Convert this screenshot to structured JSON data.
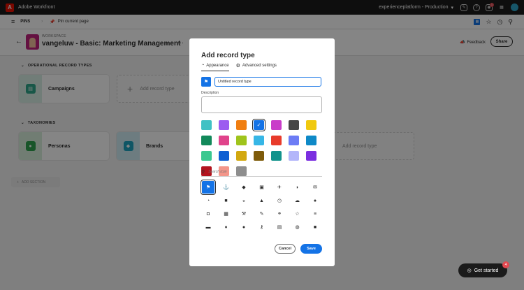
{
  "topbar": {
    "app_name": "Adobe Workfront",
    "org": "experienceplatform - Production",
    "notification_count": "1"
  },
  "pinsbar": {
    "pins_label": "PINS",
    "pin_current": "Pin current page"
  },
  "header": {
    "workspace_label": "WORKSPACE",
    "workspace_title": "vangeluw - Basic: Marketing Management",
    "feedback": "Feedback",
    "share": "Share"
  },
  "sections": {
    "operational": {
      "title": "OPERATIONAL RECORD TYPES",
      "cards": [
        {
          "name": "Campaigns",
          "color": "#2ea88a"
        }
      ],
      "add_label": "Add record type"
    },
    "taxonomies": {
      "title": "TAXONOMIES",
      "cards": [
        {
          "name": "Personas",
          "color": "#2ea44f"
        },
        {
          "name": "Brands",
          "color": "#1ea6c1"
        }
      ],
      "add_label": "Add record type"
    },
    "add_section": "ADD SECTION"
  },
  "modal": {
    "title": "Add record type",
    "tabs": [
      {
        "label": "Appearance",
        "icon": "brush-icon",
        "active": true
      },
      {
        "label": "Advanced settings",
        "icon": "gear-icon",
        "active": false
      }
    ],
    "name_value": "Untitled record type",
    "description_label": "Description",
    "description_value": "",
    "colors": [
      "#40c1c4",
      "#9c5cf0",
      "#f07e11",
      "#1473e6",
      "#c93dc9",
      "#464646",
      "#f0c90f",
      "#12895a",
      "#e0438b",
      "#9fc41c",
      "#36b6e6",
      "#e83b2b",
      "#6c7cf5",
      "#0e89c7",
      "#3bc890",
      "#0f5fd2",
      "#d2a80f",
      "#7e5b0a",
      "#12938c",
      "#b3b6fa",
      "#7b2fe0",
      "#b3141e",
      "#f3968a",
      "#8e8e8e"
    ],
    "selected_color_index": 3,
    "search_placeholder": "Search icon",
    "icons": [
      {
        "name": "flag-icon",
        "glyph": "⚑"
      },
      {
        "name": "anchor-icon",
        "glyph": "⚓"
      },
      {
        "name": "tag-icon",
        "glyph": "◆"
      },
      {
        "name": "image-icon",
        "glyph": "▣"
      },
      {
        "name": "airplane-icon",
        "glyph": "✈"
      },
      {
        "name": "shield-icon",
        "glyph": "◗"
      },
      {
        "name": "email-icon",
        "glyph": "✉"
      },
      {
        "name": "brush-icon",
        "glyph": "◔"
      },
      {
        "name": "box-icon",
        "glyph": "■"
      },
      {
        "name": "car-icon",
        "glyph": "◒"
      },
      {
        "name": "alert-icon",
        "glyph": "▲"
      },
      {
        "name": "clock-icon",
        "glyph": "◷"
      },
      {
        "name": "cloud-icon",
        "glyph": "☁"
      },
      {
        "name": "bell-icon",
        "glyph": "♠"
      },
      {
        "name": "money-icon",
        "glyph": "◘"
      },
      {
        "name": "calculator-icon",
        "glyph": "▦"
      },
      {
        "name": "hammer-icon",
        "glyph": "⚒"
      },
      {
        "name": "pencil-icon",
        "glyph": "✎"
      },
      {
        "name": "link-icon",
        "glyph": "⚭"
      },
      {
        "name": "star-icon",
        "glyph": "☆"
      },
      {
        "name": "database-icon",
        "glyph": "≡"
      },
      {
        "name": "briefcase-icon",
        "glyph": "▬"
      },
      {
        "name": "location-icon",
        "glyph": "♦"
      },
      {
        "name": "target-icon",
        "glyph": "●"
      },
      {
        "name": "key-icon",
        "glyph": "⚷"
      },
      {
        "name": "calendar-icon",
        "glyph": "▤"
      },
      {
        "name": "globe-icon",
        "glyph": "◍"
      },
      {
        "name": "video-icon",
        "glyph": "■"
      }
    ],
    "selected_icon_index": 0,
    "cancel": "Cancel",
    "save": "Save"
  },
  "get_started": {
    "label": "Get started",
    "count": "4"
  }
}
